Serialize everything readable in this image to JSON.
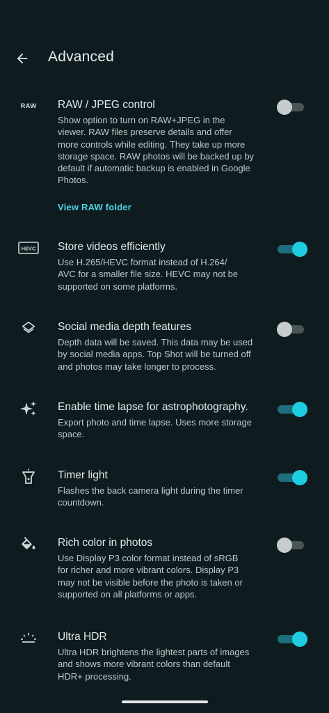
{
  "header": {
    "title": "Advanced",
    "back_icon": "arrow-left-icon"
  },
  "colors": {
    "background": "#0f1c1f",
    "accent": "#1fcde3",
    "link": "#4fd3e8"
  },
  "settings": [
    {
      "id": "raw-jpeg",
      "icon": "raw-icon",
      "icon_text": "RAW",
      "title": "RAW / JPEG control",
      "desc_lines": [
        "Show option to turn on RAW+JPEG in the",
        "viewer. RAW files preserve details and offer",
        "more controls while editing. They take up more",
        "storage space. RAW photos will be backed up by",
        "default if automatic backup is enabled in Google",
        "Photos."
      ],
      "link": "View RAW folder",
      "enabled": false
    },
    {
      "id": "hevc",
      "icon": "hevc-icon",
      "icon_text": "HEVC",
      "title": "Store videos efficiently",
      "desc_lines": [
        "Use H.265/HEVC format instead of H.264/",
        "AVC for a smaller file size. HEVC may not be",
        "supported on some platforms."
      ],
      "enabled": true
    },
    {
      "id": "depth",
      "icon": "layers-icon",
      "title": "Social media depth features",
      "desc_lines": [
        "Depth data will be saved. This data may be used",
        "by social media apps. Top Shot will be turned off",
        "and photos may take longer to process."
      ],
      "enabled": false
    },
    {
      "id": "astro",
      "icon": "sparkle-icon",
      "title": "Enable time lapse for astrophotography.",
      "desc_lines": [
        "Export photo and time lapse. Uses more storage",
        "space."
      ],
      "enabled": true
    },
    {
      "id": "timer-light",
      "icon": "flashlight-icon",
      "title": "Timer light",
      "desc_lines": [
        "Flashes the back camera light during the timer",
        "countdown."
      ],
      "enabled": true
    },
    {
      "id": "rich-color",
      "icon": "paint-bucket-icon",
      "title": "Rich color in photos",
      "desc_lines": [
        "Use Display P3 color format instead of sRGB",
        "for richer and more vibrant colors. Display P3",
        "may not be visible before the photo is taken or",
        "supported on all platforms or apps."
      ],
      "enabled": false
    },
    {
      "id": "ultra-hdr",
      "icon": "hdr-sunrise-icon",
      "title": "Ultra HDR",
      "desc_lines": [
        "Ultra HDR brightens the lightest parts of images",
        "and shows more vibrant colors than default",
        "HDR+ processing."
      ],
      "enabled": true
    }
  ]
}
